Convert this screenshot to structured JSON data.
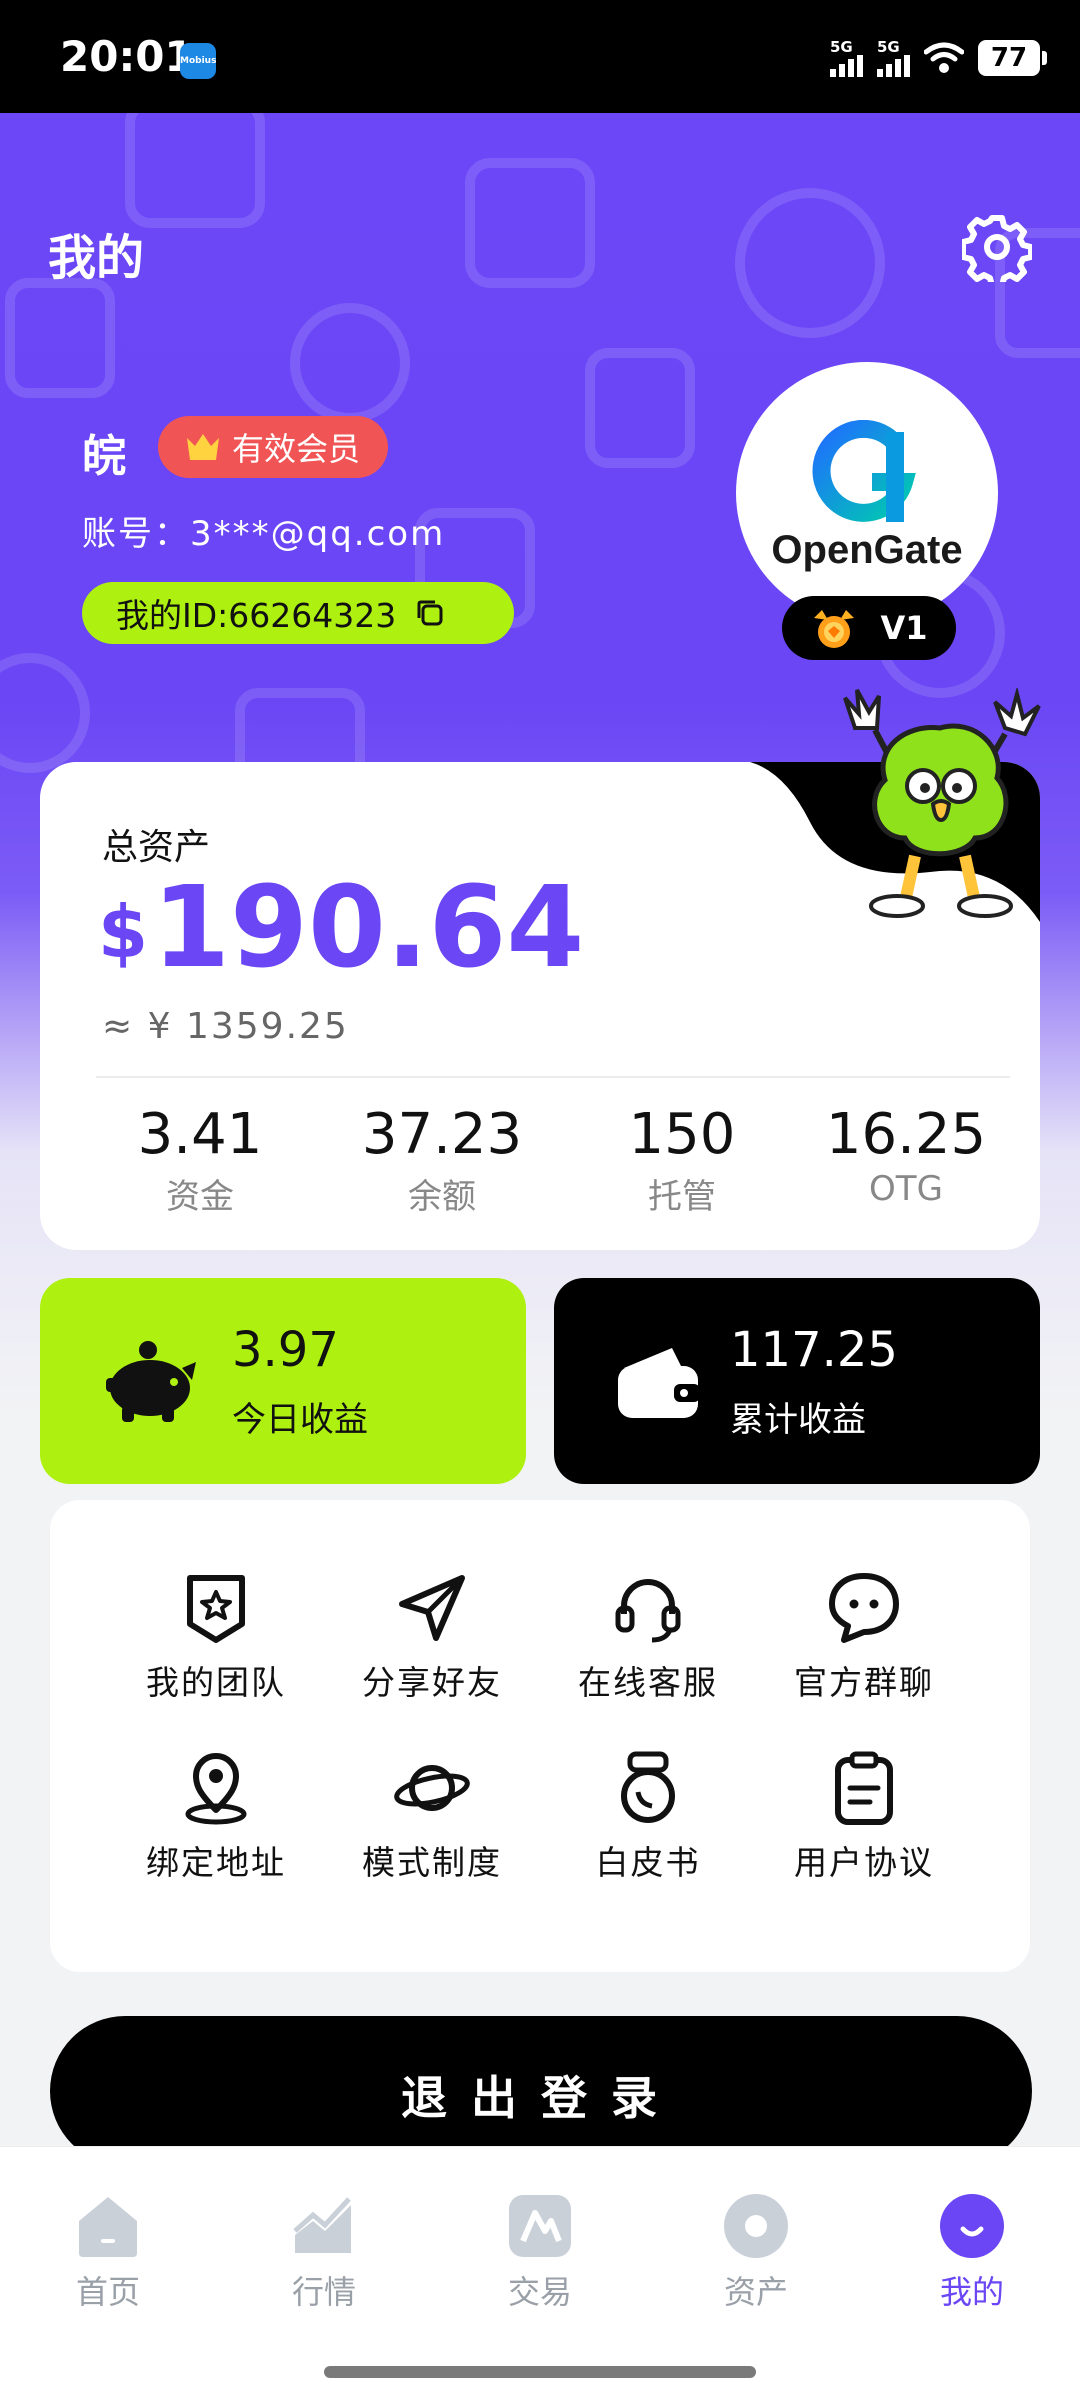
{
  "status_bar": {
    "time": "20:01",
    "app_icon_text": "Mobius",
    "sim1": "5G",
    "sim2": "5G",
    "battery": "77"
  },
  "header": {
    "title": "我的",
    "settings_icon": "gear-icon"
  },
  "profile": {
    "username": "皖",
    "member_badge": "有效会员",
    "account": "账号：3***@qq.com",
    "id_label": "我的ID:66264323",
    "avatar_brand": "OpenGate",
    "level": "V1"
  },
  "assets": {
    "total_label": "总资产",
    "currency_symbol": "$",
    "total_value": "190.64",
    "cny_value": "≈ ¥ 1359.25",
    "stats": [
      {
        "value": "3.41",
        "label": "资金"
      },
      {
        "value": "37.23",
        "label": "余额"
      },
      {
        "value": "150",
        "label": "托管"
      },
      {
        "value": "16.25",
        "label": "OTG"
      }
    ]
  },
  "earnings": {
    "today": {
      "value": "3.97",
      "label": "今日收益",
      "icon": "piggy-bank-icon"
    },
    "total": {
      "value": "117.25",
      "label": "累计收益",
      "icon": "wallet-icon"
    }
  },
  "menu": [
    {
      "label": "我的团队",
      "icon": "team-badge-icon"
    },
    {
      "label": "分享好友",
      "icon": "paper-plane-icon"
    },
    {
      "label": "在线客服",
      "icon": "headset-icon"
    },
    {
      "label": "官方群聊",
      "icon": "chat-bubble-icon"
    },
    {
      "label": "绑定地址",
      "icon": "location-pin-icon"
    },
    {
      "label": "模式制度",
      "icon": "planet-icon"
    },
    {
      "label": "白皮书",
      "icon": "whitepaper-icon"
    },
    {
      "label": "用户协议",
      "icon": "clipboard-icon"
    }
  ],
  "logout_label": "退出登录",
  "tabs": [
    {
      "label": "首页",
      "icon": "home-icon",
      "active": false
    },
    {
      "label": "行情",
      "icon": "chart-icon",
      "active": false
    },
    {
      "label": "交易",
      "icon": "trade-icon",
      "active": false
    },
    {
      "label": "资产",
      "icon": "asset-icon",
      "active": false
    },
    {
      "label": "我的",
      "icon": "profile-icon",
      "active": true
    }
  ],
  "colors": {
    "brand_purple": "#6a46f5",
    "lime": "#aef00f",
    "badge_red": "#f05455"
  }
}
